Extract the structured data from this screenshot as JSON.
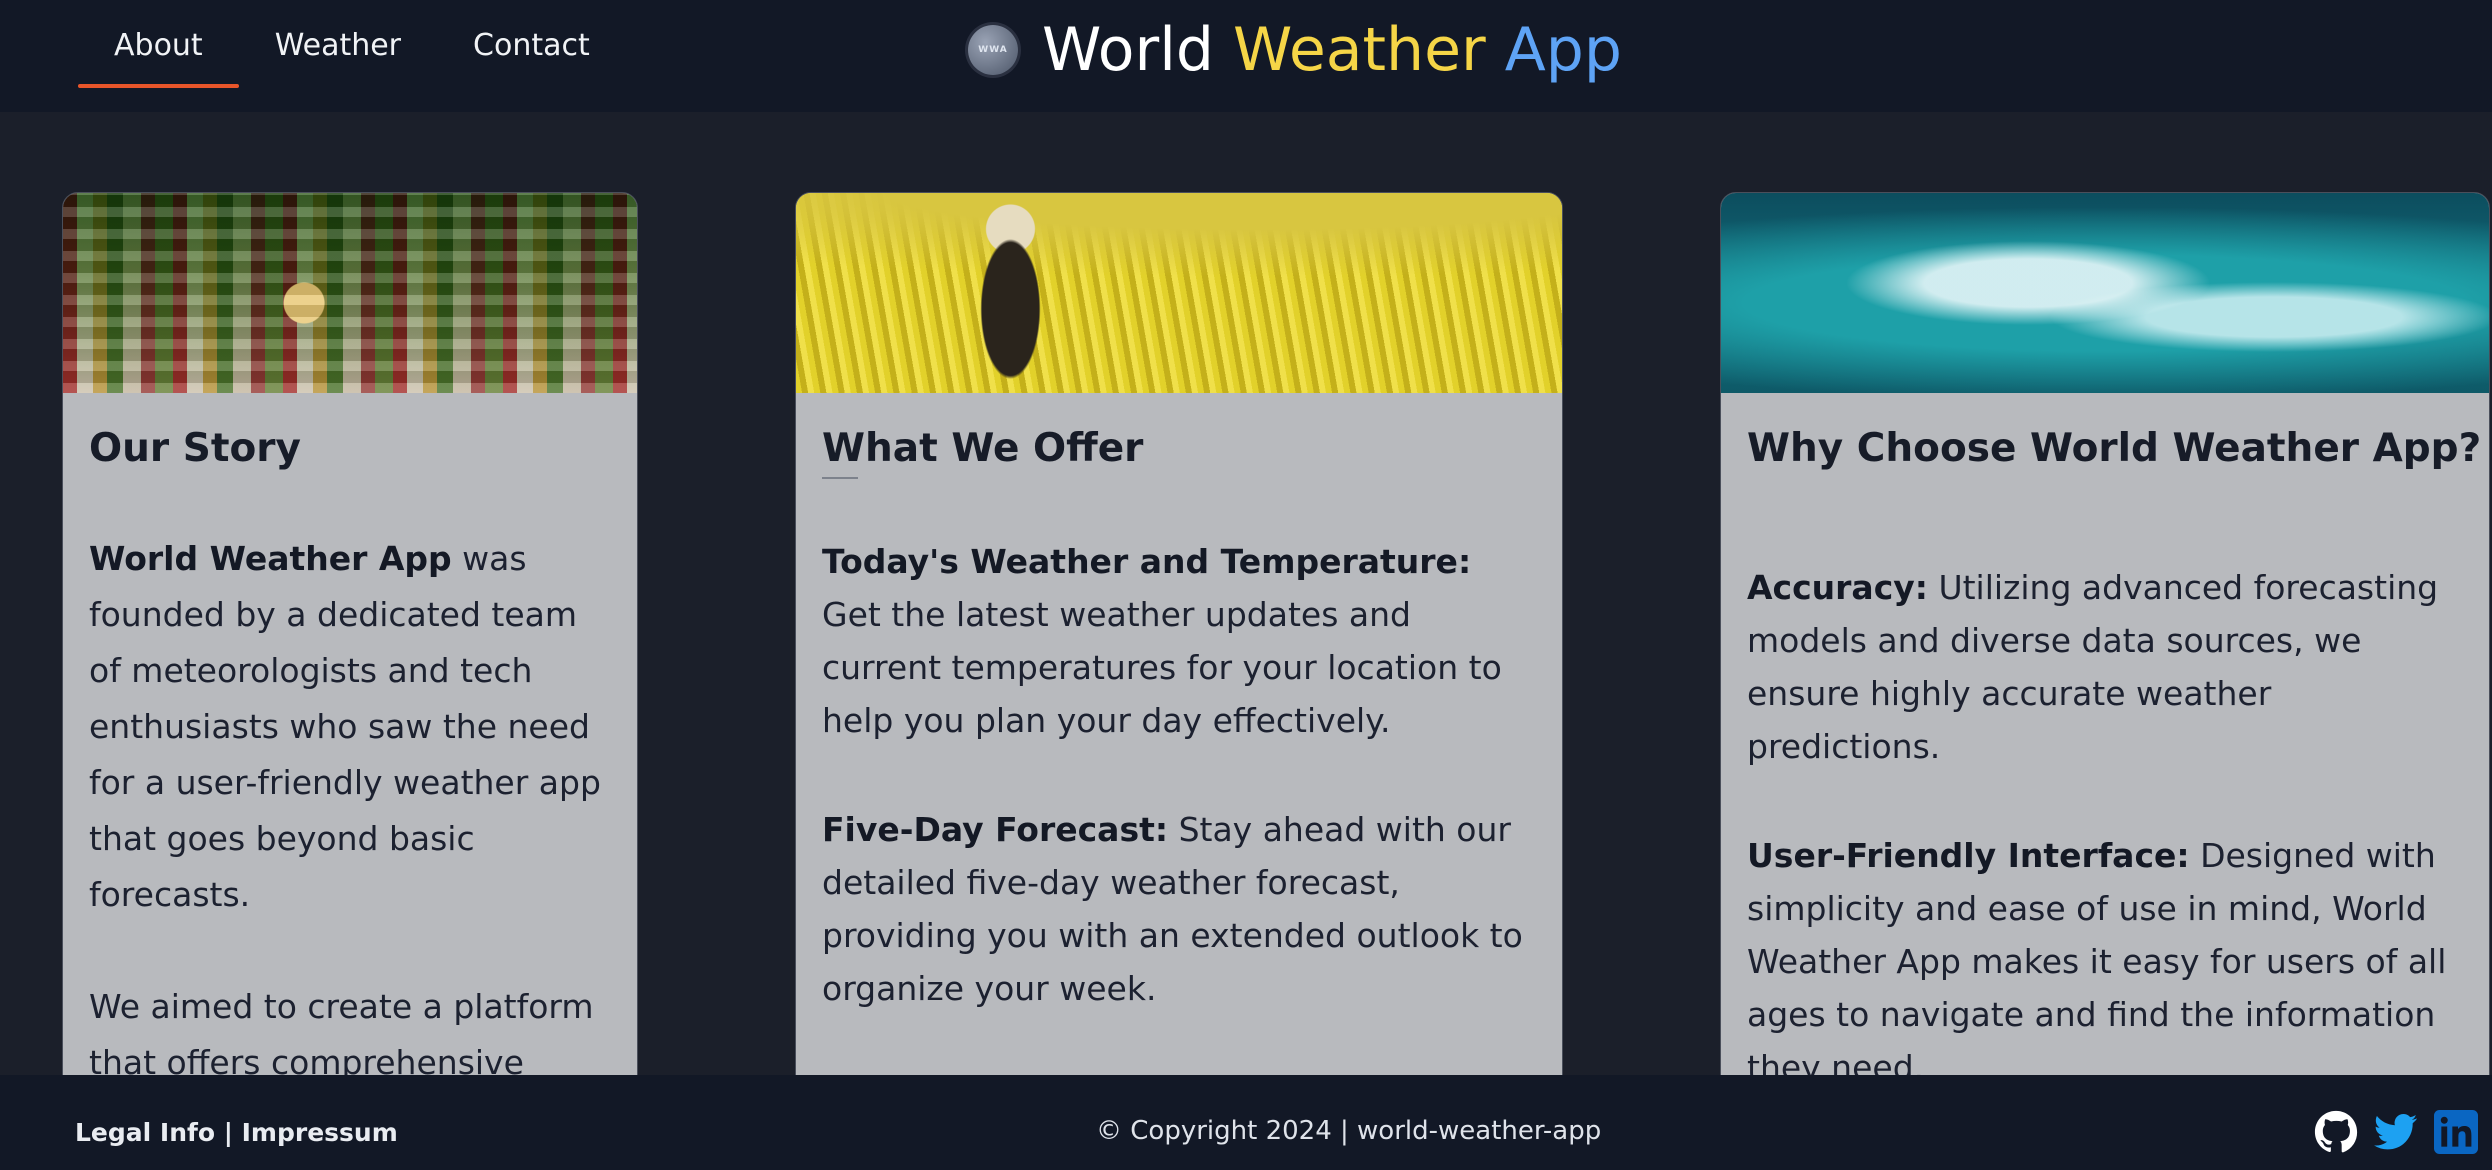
{
  "nav": {
    "items": [
      {
        "label": "About",
        "active": true
      },
      {
        "label": "Weather",
        "active": false
      },
      {
        "label": "Contact",
        "active": false
      }
    ]
  },
  "brand": {
    "logo_text": "WWA",
    "title_world": "World",
    "title_weather": "Weather",
    "title_app": "App",
    "colors": {
      "world": "#ffffff",
      "weather": "#f5d547",
      "app": "#5ea3f5"
    }
  },
  "cards": [
    {
      "title": "Our Story",
      "image": "colorful-hillside-town-image",
      "paragraphs": [
        {
          "bold": "World Weather App",
          "text": " was founded by a dedicated team of meteorologists and tech enthusiasts who saw the need for a user-friendly weather app that goes beyond basic forecasts."
        },
        {
          "bold": "",
          "text": "We aimed to create a platform that offers comprehensive"
        }
      ]
    },
    {
      "title": "What We Offer",
      "image": "yellow-flower-field-image",
      "paragraphs": [
        {
          "bold": "Today's Weather and Temperature:",
          "text": " Get the latest weather updates and current temperatures for your location to help you plan your day effectively."
        },
        {
          "bold": "Five-Day Forecast:",
          "text": " Stay ahead with our detailed five-day weather forecast, providing you with an extended outlook to organize your week."
        }
      ]
    },
    {
      "title": "Why Choose World Weather App?",
      "image": "ocean-wave-image",
      "paragraphs": [
        {
          "bold": "Accuracy:",
          "text": " Utilizing advanced forecasting models and diverse data sources, we ensure highly accurate weather predictions."
        },
        {
          "bold": "User-Friendly Interface:",
          "text": " Designed with simplicity and ease of use in mind, World Weather App makes it easy for users of all ages to navigate and find the information they need."
        }
      ]
    }
  ],
  "footer": {
    "legal_info": "Legal Info",
    "separator": " | ",
    "impressum": "Impressum",
    "copyright": "© Copyright 2024 | world-weather-app",
    "socials": [
      "github-icon",
      "twitter-icon",
      "linkedin-icon"
    ]
  },
  "colors": {
    "accent": "#e8552a",
    "header_bg": "#121826",
    "page_bg": "#1b1f2a",
    "card_bg": "#b8babe"
  }
}
